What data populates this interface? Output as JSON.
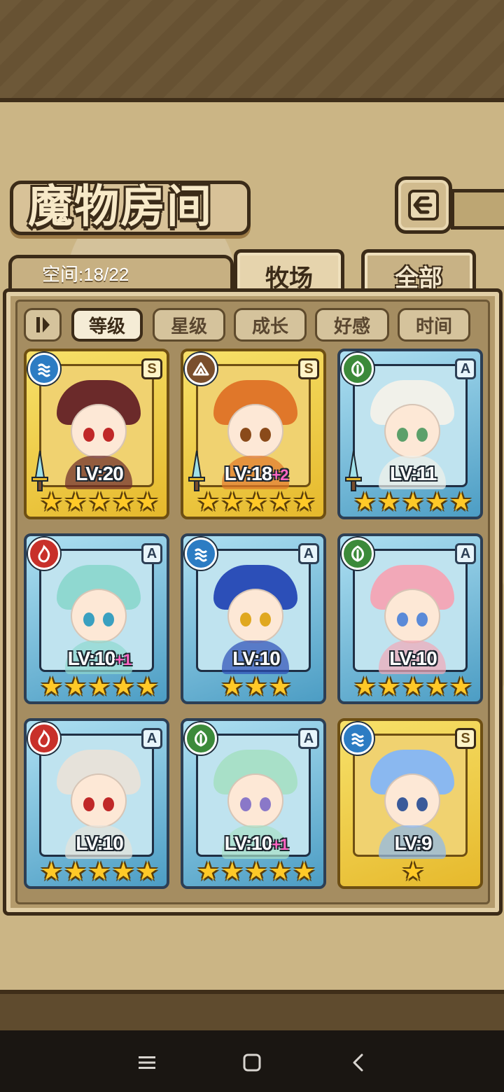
{
  "header": {
    "title": "魔物房间"
  },
  "space": {
    "label": "空间:18/22"
  },
  "tabs": [
    {
      "label": "牧场",
      "active": true
    },
    {
      "label": "全部",
      "active": false
    }
  ],
  "sort_options": [
    {
      "label": "等级",
      "active": true
    },
    {
      "label": "星级",
      "active": false
    },
    {
      "label": "成长",
      "active": false
    },
    {
      "label": "好感",
      "active": false
    },
    {
      "label": "时间",
      "active": false
    }
  ],
  "monsters": [
    {
      "level": "LV:20",
      "bonus": "",
      "rank": "S",
      "element": "water",
      "stars": 5,
      "frame": "gold",
      "weapon": true,
      "hair": "#6b2a2a",
      "eyes": "#c02828"
    },
    {
      "level": "LV:18",
      "bonus": "+2",
      "rank": "S",
      "element": "earth",
      "stars": 5,
      "frame": "gold",
      "weapon": true,
      "hair": "#e0772a",
      "eyes": "#8a4a1a"
    },
    {
      "level": "LV:11",
      "bonus": "",
      "rank": "A",
      "element": "wind",
      "stars": 5,
      "frame": "blue",
      "weapon": true,
      "hair": "#f1f1ea",
      "eyes": "#5ca06a"
    },
    {
      "level": "LV:10",
      "bonus": "+1",
      "rank": "A",
      "element": "fire",
      "stars": 5,
      "frame": "blue",
      "weapon": false,
      "hair": "#8fd8d0",
      "eyes": "#3aa0c0"
    },
    {
      "level": "LV:10",
      "bonus": "",
      "rank": "A",
      "element": "water",
      "stars": 3,
      "frame": "blue",
      "weapon": false,
      "hair": "#2c4fb8",
      "eyes": "#e0a820"
    },
    {
      "level": "LV:10",
      "bonus": "",
      "rank": "A",
      "element": "wind",
      "stars": 5,
      "frame": "blue",
      "weapon": false,
      "hair": "#f2a8b8",
      "eyes": "#5a8ad8"
    },
    {
      "level": "LV:10",
      "bonus": "",
      "rank": "A",
      "element": "fire",
      "stars": 5,
      "frame": "blue",
      "weapon": false,
      "hair": "#e6e2da",
      "eyes": "#c02828"
    },
    {
      "level": "LV:10",
      "bonus": "+1",
      "rank": "A",
      "element": "wind",
      "stars": 5,
      "frame": "blue",
      "weapon": false,
      "hair": "#a8e0c8",
      "eyes": "#8a78c8"
    },
    {
      "level": "LV:9",
      "bonus": "",
      "rank": "S",
      "element": "water",
      "stars": 1,
      "frame": "gold",
      "weapon": false,
      "hair": "#8ab8f0",
      "eyes": "#3a5a9a"
    }
  ],
  "icons": {
    "back": "back-arrow-icon",
    "toggle": "sort-toggle-icon",
    "nav": [
      "menu-icon",
      "home-icon",
      "back-chevron-icon"
    ]
  },
  "colors": {
    "panel": "#cbb585",
    "border": "#3b2b18",
    "gold_frame": "#e6b92c",
    "blue_frame": "#4c9dc4",
    "star": "#ffc928",
    "bonus": "#ff66c4"
  }
}
